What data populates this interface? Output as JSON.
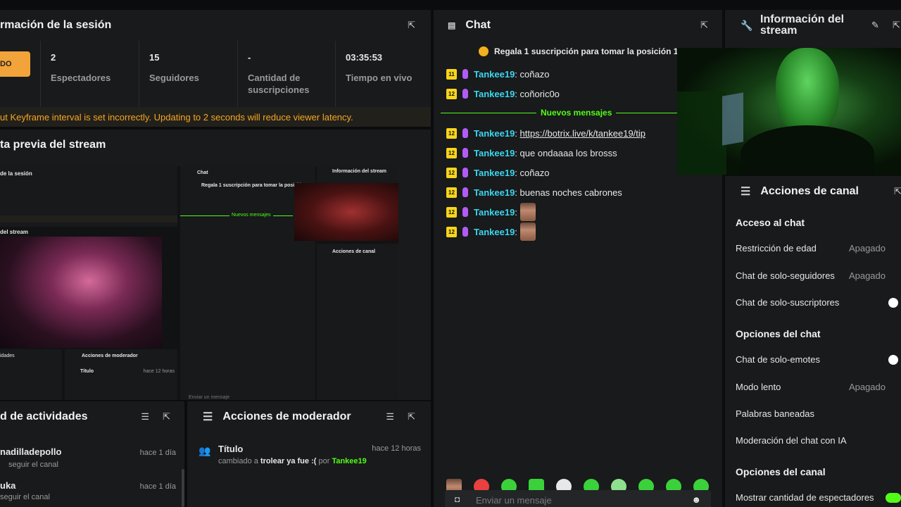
{
  "session": {
    "title": "rmación de la sesión",
    "status_badge": "DO",
    "stats": [
      {
        "value": "2",
        "label": "Espectadores"
      },
      {
        "value": "15",
        "label": "Seguidores"
      },
      {
        "value": "-",
        "label": "Cantidad de suscripciones"
      },
      {
        "value": "03:35:53",
        "label": "Tiempo en vivo"
      }
    ],
    "warning": "ut Keyframe interval is set incorrectly. Updating to 2 seconds will reduce viewer latency."
  },
  "preview": {
    "title": "ta previa del stream",
    "nested": {
      "session_title": "de la sesión",
      "chat_title": "Chat",
      "info_title": "Información del stream",
      "stream_label": "del stream",
      "pinned": "Regala 1 suscripción para tomar la posición",
      "new_messages": "Nuevos mensajes",
      "actions_title": "Acciones de canal",
      "mod_title": "Acciones de moderador",
      "activities": "idades",
      "mod_item_title": "Título",
      "mod_item_time": "hace 12 horas",
      "input_placeholder": "Enviar un mensaje"
    }
  },
  "activity": {
    "title": "d de actividades",
    "items": [
      {
        "user": "nadilladepollo",
        "action": "seguir el canal",
        "time": "hace 1 día"
      },
      {
        "user": "uka",
        "action": "seguir el canal",
        "time": "hace 1 día"
      }
    ]
  },
  "moderator": {
    "title": "Acciones de moderador",
    "item_title": "Título",
    "item_time": "hace 12 horas",
    "item_desc_prefix": "cambiado a",
    "item_desc_value": "trolear ya fue :(",
    "item_desc_by": "por",
    "item_desc_user": "Tankee19"
  },
  "chat": {
    "title": "Chat",
    "pinned": "Regala 1 suscripción para tomar la posición 1",
    "new_messages_label": "Nuevos mensajes",
    "messages": [
      {
        "badge": "11",
        "user": "Tankee19",
        "text": "coñazo"
      },
      {
        "badge": "12",
        "user": "Tankee19",
        "text": "coñoric0o"
      },
      {
        "badge": "12",
        "user": "Tankee19",
        "text": "https://botrix.live/k/tankee19/tip"
      },
      {
        "badge": "12",
        "user": "Tankee19",
        "text": "que ondaaaa los brosss"
      },
      {
        "badge": "12",
        "user": "Tankee19",
        "text": "coñazo"
      },
      {
        "badge": "12",
        "user": "Tankee19",
        "text": "buenas noches cabrones"
      },
      {
        "badge": "12",
        "user": "Tankee19",
        "text": ""
      },
      {
        "badge": "12",
        "user": "Tankee19",
        "text": ""
      }
    ],
    "input_placeholder": "Enviar un mensaje"
  },
  "info": {
    "title": "Información del stream"
  },
  "actions": {
    "title": "Acciones de canal",
    "chat_access": "Acceso al chat",
    "age_restriction": {
      "label": "Restricción de edad",
      "value": "Apagado"
    },
    "followers_only": {
      "label": "Chat de solo-seguidores",
      "value": "Apagado"
    },
    "subs_only": {
      "label": "Chat de solo-suscriptores"
    },
    "chat_options": "Opciones del chat",
    "emotes_only": {
      "label": "Chat de solo-emotes"
    },
    "slow_mode": {
      "label": "Modo lento",
      "value": "Apagado"
    },
    "banned_words": {
      "label": "Palabras baneadas"
    },
    "ai_mod": {
      "label": "Moderación del chat con IA"
    },
    "channel_options": "Opciones del canal",
    "show_viewers": {
      "label": "Mostrar cantidad de espectadores"
    }
  },
  "colors": {
    "accent": "#53fc18",
    "username": "#3bd6f0",
    "warning": "#f5a623",
    "badge": "#f7d51b"
  }
}
